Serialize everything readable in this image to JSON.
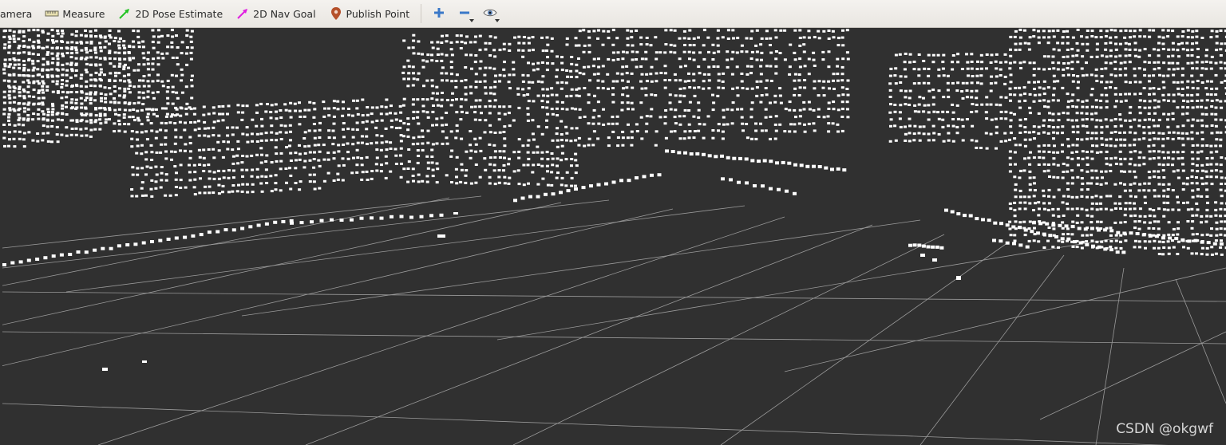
{
  "toolbar": {
    "tools": [
      {
        "name": "camera",
        "label": "amera",
        "icon": "camera-icon"
      },
      {
        "name": "measure",
        "label": "Measure",
        "icon": "ruler-icon"
      },
      {
        "name": "pose-estimate",
        "label": "2D Pose Estimate",
        "icon": "green-arrow-icon"
      },
      {
        "name": "nav-goal",
        "label": "2D Nav Goal",
        "icon": "magenta-arrow-icon"
      },
      {
        "name": "publish-point",
        "label": "Publish Point",
        "icon": "map-pin-icon"
      }
    ],
    "actions": [
      "add-tool-icon",
      "remove-tool-icon",
      "view-icon"
    ],
    "colors": {
      "pose_arrow": "#22c322",
      "nav_arrow": "#e020e0",
      "pin": "#b5502a",
      "plus": "#3a78c8"
    }
  },
  "viewport": {
    "background": "#303030",
    "grid_color": "#9a9a9a",
    "point_color": "#ffffff"
  },
  "watermark": "CSDN @okgwf"
}
